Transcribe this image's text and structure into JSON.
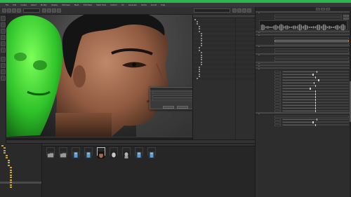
{
  "titlebar": {
    "color": "#2fb550"
  },
  "menu": {
    "items": [
      "File",
      "Edit",
      "Create",
      "Select",
      "Modify",
      "Display",
      "Windows",
      "Mesh",
      "Edit Mesh",
      "Mesh Tools",
      "Deform",
      "UV",
      "Generate",
      "Cache",
      "Arnold",
      "Help"
    ]
  },
  "dialog": {
    "title": "",
    "ok_label": "",
    "cancel_label": ""
  },
  "outliner": {
    "rows": [
      {
        "label": "",
        "depth": 0
      },
      {
        "label": "",
        "depth": 1
      },
      {
        "label": "",
        "depth": 1
      },
      {
        "label": "",
        "depth": 2
      },
      {
        "label": "",
        "depth": 2
      },
      {
        "label": "",
        "depth": 2
      },
      {
        "label": "",
        "depth": 3
      },
      {
        "label": "",
        "depth": 3
      },
      {
        "label": "",
        "depth": 3
      },
      {
        "label": "",
        "depth": 3
      },
      {
        "label": "",
        "depth": 3
      },
      {
        "label": "",
        "depth": 3
      },
      {
        "label": "",
        "depth": 2
      },
      {
        "label": "",
        "depth": 2
      },
      {
        "label": "",
        "depth": 3
      },
      {
        "label": "",
        "depth": 3
      },
      {
        "label": "",
        "depth": 3
      },
      {
        "label": "",
        "depth": 3
      },
      {
        "label": "",
        "depth": 3
      },
      {
        "label": "",
        "depth": 3
      },
      {
        "label": "",
        "depth": 2
      },
      {
        "label": "",
        "depth": 2
      },
      {
        "label": "",
        "depth": 2
      },
      {
        "label": "",
        "depth": 2
      },
      {
        "label": "",
        "depth": 2
      },
      {
        "label": "",
        "depth": 1
      }
    ]
  },
  "right_panel": {
    "sections": [
      {
        "label": ""
      },
      {
        "label": ""
      },
      {
        "label": ""
      },
      {
        "label": ""
      },
      {
        "label": ""
      },
      {
        "label": ""
      },
      {
        "label": ""
      },
      {
        "label": ""
      },
      {
        "label": ""
      }
    ],
    "slider_values": [
      0.52,
      0.46,
      0.5,
      0.55,
      0.48,
      0.5,
      0.42,
      0.5,
      0.5,
      0.5,
      0.5,
      0.5,
      0.5,
      0.5,
      0.5
    ],
    "accent": "#d8721c"
  },
  "file_tree": {
    "rows": [
      {
        "label": "",
        "depth": 0
      },
      {
        "label": "",
        "depth": 1
      },
      {
        "label": "",
        "depth": 1
      },
      {
        "label": "",
        "depth": 1
      },
      {
        "label": "",
        "depth": 2
      },
      {
        "label": "",
        "depth": 2
      },
      {
        "label": "",
        "depth": 3
      },
      {
        "label": "",
        "depth": 3
      },
      {
        "label": "",
        "depth": 3
      },
      {
        "label": "",
        "depth": 4
      },
      {
        "label": "",
        "depth": 4
      },
      {
        "label": "",
        "depth": 4
      },
      {
        "label": "",
        "depth": 4
      },
      {
        "label": "",
        "depth": 4
      },
      {
        "label": "",
        "depth": 4
      },
      {
        "label": "",
        "depth": 4
      },
      {
        "label": "",
        "depth": 4
      },
      {
        "label": "",
        "depth": 4
      }
    ],
    "selected_index": 15,
    "folder_color": "#c7a446"
  },
  "file_grid": {
    "items": [
      {
        "label": "",
        "kind": "folder"
      },
      {
        "label": "",
        "kind": "folder"
      },
      {
        "label": "",
        "kind": "file"
      },
      {
        "label": "",
        "kind": "file"
      },
      {
        "label": "",
        "kind": "face"
      },
      {
        "label": "",
        "kind": "head"
      },
      {
        "label": "",
        "kind": "bust"
      },
      {
        "label": "",
        "kind": "file"
      },
      {
        "label": "",
        "kind": "file"
      }
    ],
    "selected_index": 4
  }
}
